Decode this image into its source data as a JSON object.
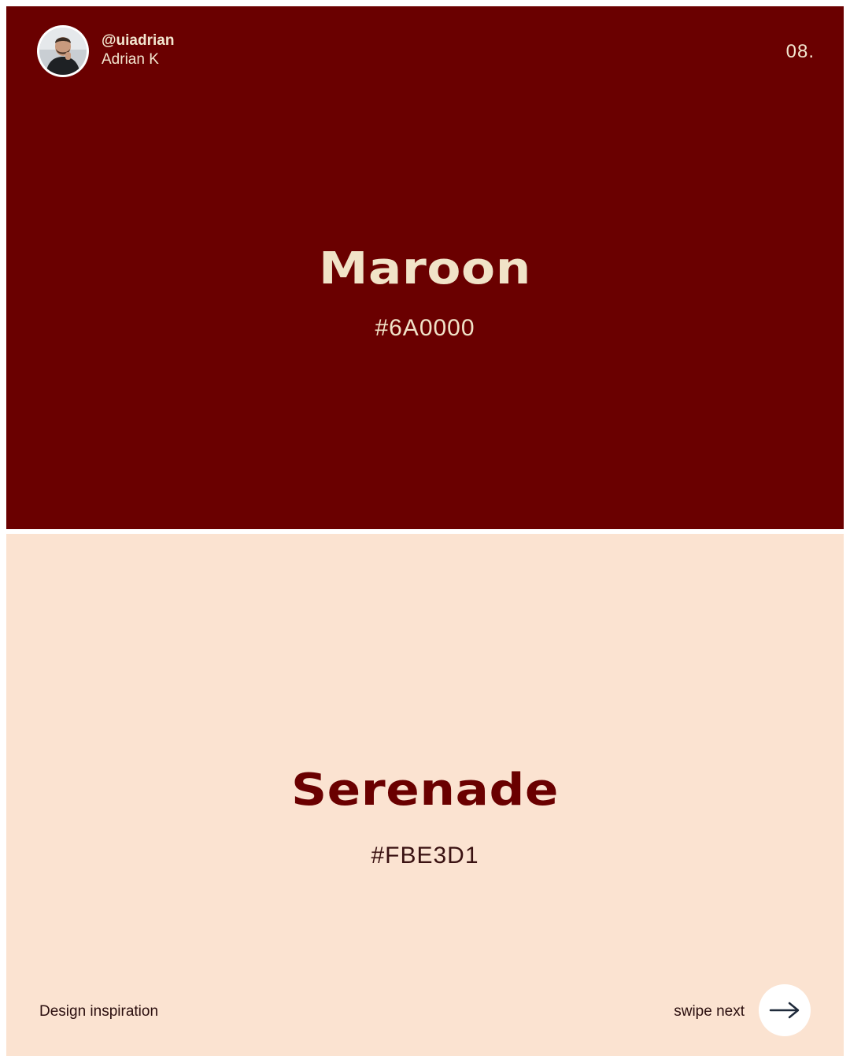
{
  "author": {
    "handle": "@uiadrian",
    "name": "Adrian K",
    "avatar_icon": "person-avatar-icon"
  },
  "page_number": "08.",
  "colors": [
    {
      "name": "Maroon",
      "hex_label": "#6A0000",
      "swatch": "#6A0000"
    },
    {
      "name": "Serenade",
      "hex_label": "#FBE3D1",
      "swatch": "#FBE3D1"
    }
  ],
  "footer": {
    "left_label": "Design inspiration",
    "swipe_label": "swipe next",
    "next_icon": "arrow-right-icon"
  },
  "theme": {
    "cream_text": "#F1E3C8",
    "maroon": "#6A0000",
    "dark_text": "#2A0E0E",
    "arrow": "#1F2A3A"
  }
}
